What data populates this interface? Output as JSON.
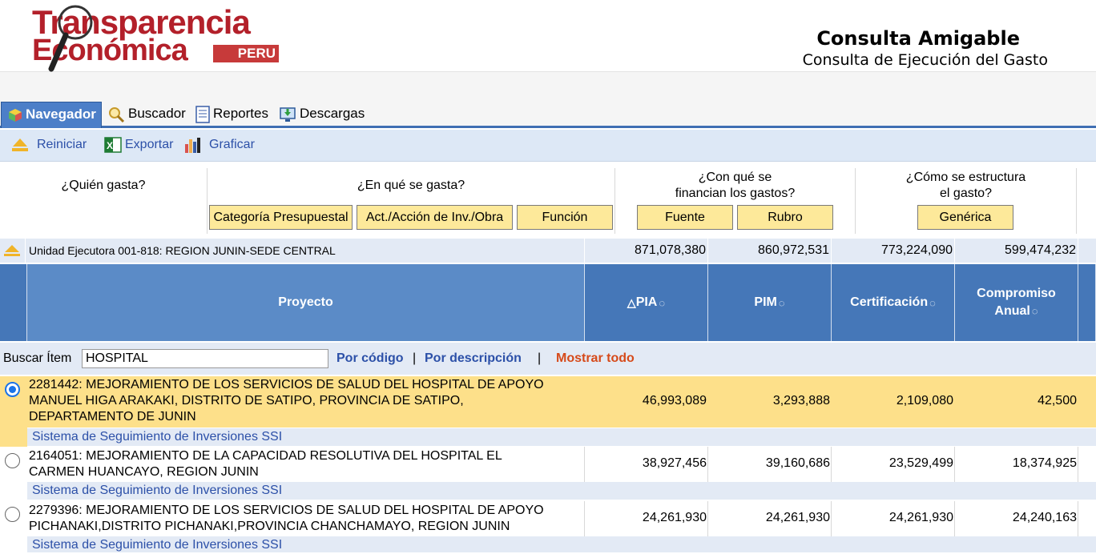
{
  "header": {
    "logo_line1": "Transparencia",
    "logo_line2": "Económica",
    "logo_badge": "PERU",
    "title": "Consulta Amigable",
    "subtitle": "Consulta de Ejecución del Gasto"
  },
  "nav": {
    "tabs": [
      {
        "label": "Navegador",
        "icon": "cube-icon",
        "active": true
      },
      {
        "label": "Buscador",
        "icon": "magnifier-icon",
        "active": false
      },
      {
        "label": "Reportes",
        "icon": "document-icon",
        "active": false
      },
      {
        "label": "Descargas",
        "icon": "download-monitor-icon",
        "active": false
      }
    ]
  },
  "toolbar": {
    "reiniciar": "Reiniciar",
    "exportar": "Exportar",
    "graficar": "Graficar"
  },
  "questions": {
    "quien": "¿Quién gasta?",
    "enque": "¿En qué se gasta?",
    "conque_l1": "¿Con qué se",
    "conque_l2": "financian los gastos?",
    "como_l1": "¿Cómo se estructura",
    "como_l2": "el gasto?",
    "buttons": {
      "categoria": "Categoría Presupuestal",
      "actividad": "Act./Acción de Inv./Obra",
      "funcion": "Función",
      "fuente": "Fuente",
      "rubro": "Rubro",
      "generica": "Genérica"
    }
  },
  "summary": {
    "label": "Unidad Ejecutora 001-818: REGION JUNIN-SEDE CENTRAL",
    "pia": "871,078,380",
    "pim": "860,972,531",
    "certificacion": "773,224,090",
    "compromiso": "599,474,232"
  },
  "columns": {
    "proyecto": "Proyecto",
    "pia": "PIA",
    "pim": "PIM",
    "certificacion": "Certificación",
    "compromiso_l1": "Compromiso",
    "compromiso_l2": "Anual"
  },
  "search": {
    "label": "Buscar Ítem",
    "value": "HOSPITAL",
    "by_code": "Por código",
    "sep1": "|",
    "by_desc": "Por descripción",
    "sep2": "|",
    "show_all": "Mostrar todo"
  },
  "rows": [
    {
      "selected": true,
      "line1": "2281442: MEJORAMIENTO DE LOS SERVICIOS DE SALUD DEL HOSPITAL DE APOYO",
      "line2": "MANUEL HIGA ARAKAKI, DISTRITO DE SATIPO, PROVINCIA DE SATIPO,",
      "line3": "DEPARTAMENTO DE JUNIN",
      "pia": "46,993,089",
      "pim": "3,293,888",
      "certificacion": "2,109,080",
      "compromiso": "42,500",
      "ssi": "Sistema de Seguimiento de Inversiones SSI"
    },
    {
      "selected": false,
      "line1": "2164051: MEJORAMIENTO DE LA CAPACIDAD RESOLUTIVA DEL HOSPITAL EL",
      "line2": "CARMEN HUANCAYO, REGION JUNIN",
      "pia": "38,927,456",
      "pim": "39,160,686",
      "certificacion": "23,529,499",
      "compromiso": "18,374,925",
      "ssi": "Sistema de Seguimiento de Inversiones SSI"
    },
    {
      "selected": false,
      "line1": "2279396: MEJORAMIENTO DE LOS SERVICIOS DE SALUD DEL HOSPITAL DE APOYO",
      "line2": "PICHANAKI,DISTRITO PICHANAKI,PROVINCIA CHANCHAMAYO, REGION JUNIN",
      "pia": "24,261,930",
      "pim": "24,261,930",
      "certificacion": "24,261,930",
      "compromiso": "24,240,163",
      "ssi": "Sistema de Seguimiento de Inversiones SSI"
    }
  ],
  "colors": {
    "accent": "#4577b8",
    "selected_row": "#fde08a",
    "link": "#2c50a8",
    "show_all": "#d64a1a"
  }
}
